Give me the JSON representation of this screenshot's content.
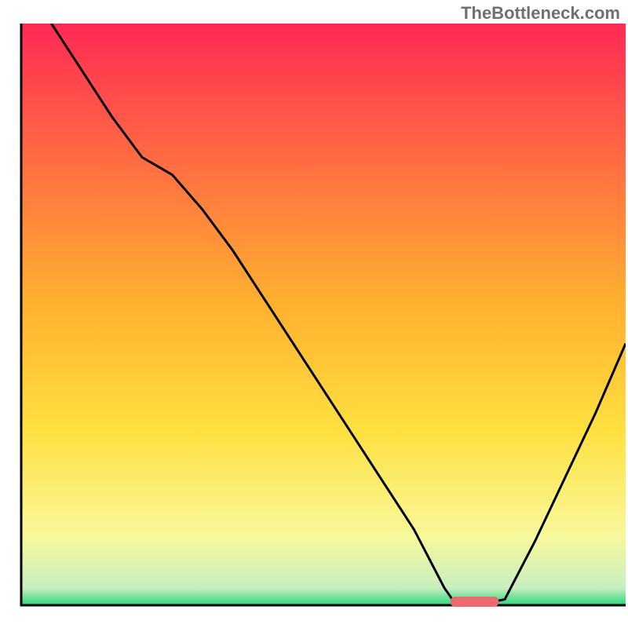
{
  "watermark": "TheBottleneck.com",
  "chart_data": {
    "type": "line",
    "title": "",
    "xlabel": "",
    "ylabel": "",
    "xlim": [
      0,
      100
    ],
    "ylim": [
      0,
      100
    ],
    "grid": false,
    "legend": false,
    "background_gradient": {
      "top_color": "#ff2a55",
      "mid_color": "#ffd030",
      "lower_color": "#f8f89a",
      "bottom_color": "#2bd67b"
    },
    "series": [
      {
        "name": "bottleneck-curve",
        "x": [
          5,
          10,
          15,
          20,
          25,
          30,
          35,
          40,
          45,
          50,
          55,
          60,
          65,
          70,
          72,
          75,
          80,
          85,
          90,
          95,
          100
        ],
        "y": [
          100,
          92,
          84,
          77,
          74,
          68,
          61,
          53,
          45,
          37,
          29,
          21,
          13,
          3,
          0,
          0,
          1,
          11,
          22,
          33,
          45
        ]
      }
    ],
    "marker": {
      "name": "optimal-range",
      "x_start": 71,
      "x_end": 79,
      "y": 0
    },
    "axes": {
      "x_visible_from": 3,
      "y_visible_from": 3
    }
  }
}
